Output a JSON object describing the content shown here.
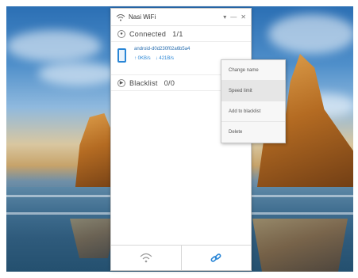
{
  "window": {
    "title": "Nasi WiFi",
    "minimize_label": "—",
    "close_label": "✕"
  },
  "connected": {
    "label": "Connected",
    "count": "1/1"
  },
  "device": {
    "name": "android-d0d230f02a6b5a4",
    "upload": "↑ 0KB/s",
    "download": "↓ 421B/s"
  },
  "blacklist": {
    "label": "Blacklist",
    "count": "0/0"
  },
  "context_menu": {
    "items": [
      "Change name",
      "Speed limit",
      "Add to blacklist",
      "Delete"
    ],
    "hovered_index": 1
  },
  "bottom_tabs": {
    "active": "settings",
    "icons": [
      "wifi-icon",
      "link-icon"
    ]
  },
  "colors": {
    "accent": "#2a86d6"
  }
}
